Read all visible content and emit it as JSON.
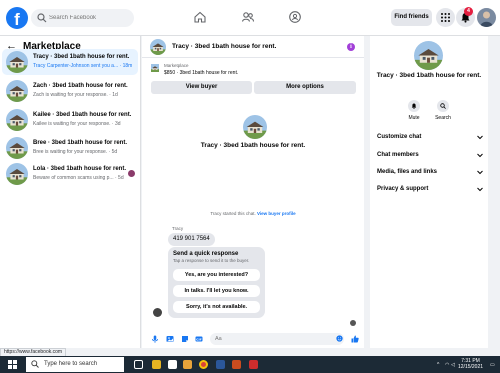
{
  "topbar": {
    "logo_letter": "f",
    "search_placeholder": "Search Facebook",
    "find_friends": "Find friends",
    "notification_count": "4"
  },
  "sidebar": {
    "title": "Marketplace",
    "conversations": [
      {
        "name": "Tracy · 3bed 1bath house for rent.",
        "preview": "Tracy Carpenter-Johnson sent you a... · 18m",
        "active": true
      },
      {
        "name": "Zach · 3bed 1bath house for rent.",
        "preview": "Zach is waiting for your response. · 1d",
        "active": false
      },
      {
        "name": "Kailee · 3bed 1bath house for rent.",
        "preview": "Kailee is waiting for your response. · 3d",
        "active": false
      },
      {
        "name": "Bree · 3bed 1bath house for rent.",
        "preview": "Bree is waiting for your response. · 5d",
        "active": false
      },
      {
        "name": "Lola · 3bed 1bath house for rent.",
        "preview": "Beware of common scams using p... · 5d",
        "active": false
      }
    ]
  },
  "chat": {
    "title": "Tracy · 3bed 1bath house for rent.",
    "listing_category": "Marketplace",
    "listing_title": "$850 · 3bed 1bath house for rent.",
    "view_buyer": "View buyer",
    "more_options": "More options",
    "center_title": "Tracy · 3bed 1bath house for rent.",
    "started_text": "Tracy started this chat.",
    "view_buyer_profile": "View buyer profile",
    "sender_name": "Tracy",
    "phone_message": "419 901 7564",
    "quick_heading": "Send a quick response",
    "quick_sub": "Tap a response to send it to the buyer.",
    "quick_responses": [
      "Yes, are you interested?",
      "In talks. I'll let you know.",
      "Sorry, it's not available."
    ],
    "composer_placeholder": "Aa"
  },
  "right_panel": {
    "name": "Tracy · 3bed 1bath house for rent.",
    "mute": "Mute",
    "search": "Search",
    "sections": [
      "Customize chat",
      "Chat members",
      "Media, files and links",
      "Privacy & support"
    ]
  },
  "status_url": "https://www.facebook.com",
  "taskbar": {
    "search_placeholder": "Type here to search",
    "time": "7:31 PM",
    "date": "12/15/2021"
  },
  "colors": {
    "accent": "#1877f2",
    "active_bg": "#e7f3ff",
    "badge": "#e41e3f",
    "info": "#a23fd8"
  }
}
